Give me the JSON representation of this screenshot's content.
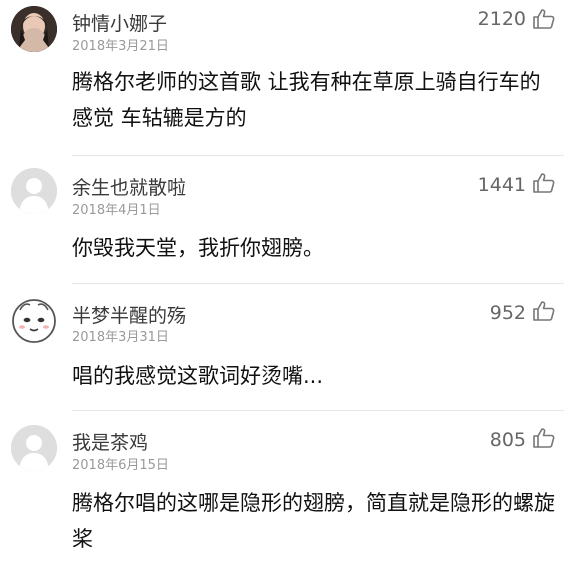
{
  "comments": [
    {
      "username": "钟情小娜子",
      "date": "2018年3月21日",
      "likes": "2120",
      "text": "腾格尔老师的这首歌 让我有种在草原上骑自行车的感觉 车轱辘是方的",
      "avatar": "photo-avatar"
    },
    {
      "username": "余生也就散啦",
      "date": "2018年4月1日",
      "likes": "1441",
      "text": "你毁我天堂，我折你翅膀。",
      "avatar": "default-person-avatar"
    },
    {
      "username": "半梦半醒的殇",
      "date": "2018年3月31日",
      "likes": "952",
      "text": "唱的我感觉这歌词好烫嘴...",
      "avatar": "cartoon-face-avatar"
    },
    {
      "username": "我是茶鸡",
      "date": "2018年6月15日",
      "likes": "805",
      "text": "腾格尔唱的这哪是隐形的翅膀，简直就是隐形的螺旋桨",
      "avatar": "default-person-avatar"
    }
  ],
  "colors": {
    "username": "#3a3a3a",
    "date": "#9a9a9a",
    "likes": "#666666",
    "divider": "#e6e6e6"
  }
}
